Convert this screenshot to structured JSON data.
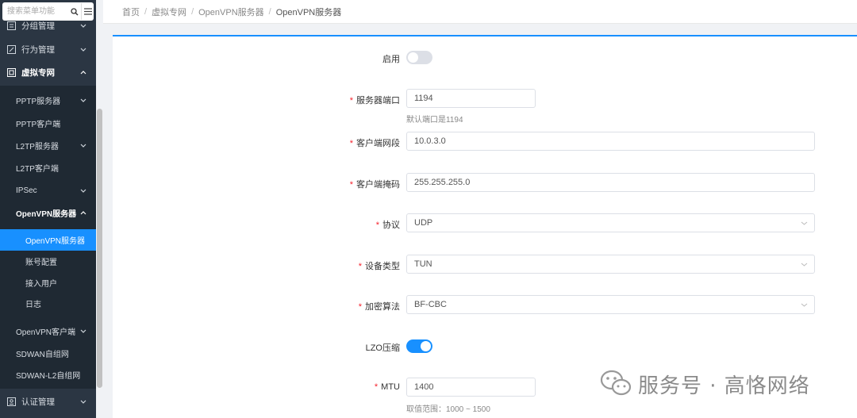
{
  "sidebar": {
    "search_placeholder": "搜索菜单功能",
    "menu_items": [
      {
        "label": "分组管理"
      },
      {
        "label": "行为管理"
      },
      {
        "label": "虚拟专网"
      },
      {
        "label": "认证管理"
      }
    ],
    "sub_items": [
      {
        "label": "PPTP服务器"
      },
      {
        "label": "PPTP客户端"
      },
      {
        "label": "L2TP服务器"
      },
      {
        "label": "L2TP客户端"
      },
      {
        "label": "IPSec"
      },
      {
        "label": "OpenVPN服务器"
      },
      {
        "label": "OpenVPN客户端"
      },
      {
        "label": "SDWAN自组网"
      },
      {
        "label": "SDWAN-L2自组网"
      }
    ],
    "leaf_items": [
      {
        "label": "OpenVPN服务器",
        "active": true
      },
      {
        "label": "账号配置"
      },
      {
        "label": "接入用户"
      },
      {
        "label": "日志"
      }
    ]
  },
  "breadcrumb": [
    "首页",
    "虚拟专网",
    "OpenVPN服务器",
    "OpenVPN服务器"
  ],
  "form": {
    "enable": {
      "label": "启用",
      "value": false
    },
    "port": {
      "label": "服务器端口",
      "value": "1194",
      "hint": "默认端口是1194"
    },
    "client_subnet": {
      "label": "客户端网段",
      "value": "10.0.3.0"
    },
    "client_mask": {
      "label": "客户端掩码",
      "value": "255.255.255.0"
    },
    "protocol": {
      "label": "协议",
      "value": "UDP"
    },
    "device_type": {
      "label": "设备类型",
      "value": "TUN"
    },
    "cipher": {
      "label": "加密算法",
      "value": "BF-CBC"
    },
    "lzo": {
      "label": "LZO压缩",
      "value": true
    },
    "mtu": {
      "label": "MTU",
      "value": "1400",
      "hint": "取值范围：1000 ~ 1500"
    }
  },
  "watermark": {
    "text": "服务号 · 高恪网络"
  },
  "colors": {
    "accent": "#1890ff",
    "sidebar_bg": "#2b3643",
    "submenu_bg": "#1f2933",
    "required": "#f5222d"
  }
}
